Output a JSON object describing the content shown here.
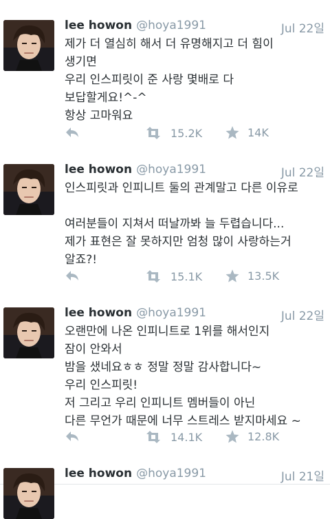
{
  "tweets": [
    {
      "name": "lee howon",
      "handle": "@hoya1991",
      "date": "Jul 22일",
      "lines": [
        "제가 더 열심히 해서 더 유명해지고 더 힘이",
        "생기면",
        "우리 인스피릿이 준 사랑 몇배로 다",
        "보답할게요!^-^",
        "항상 고마워요"
      ],
      "retweets": "15.2K",
      "favorites": "14K"
    },
    {
      "name": "lee howon",
      "handle": "@hoya1991",
      "date": "Jul 22일",
      "lines": [
        "인스피릿과 인피니트 둘의 관계말고 다른 이유로",
        "",
        "여러분들이 지쳐서 떠날까봐 늘 두렵습니다...",
        "제가 표현은 잘 못하지만 엄청 많이 사랑하는거",
        "알죠?!"
      ],
      "retweets": "15.1K",
      "favorites": "13.5K"
    },
    {
      "name": "lee howon",
      "handle": "@hoya1991",
      "date": "Jul 22일",
      "lines": [
        "오랜만에 나온 인피니트로 1위를 해서인지",
        "잠이 안와서",
        "밤을 샜네요ㅎㅎ 정말 정말 감사합니다~",
        "우리 인스피릿!",
        "저 그리고 우리 인피니트 멤버들이 아닌",
        "다른 무언가 때문에 너무 스트레스 받지마세요 ~"
      ],
      "retweets": "14.1K",
      "favorites": "12.8K"
    },
    {
      "name": "lee howon",
      "handle": "@hoya1991",
      "date": "Jul 21일",
      "lines": []
    }
  ],
  "icons": {
    "reply": "reply-icon",
    "retweet": "retweet-icon",
    "favorite": "star-icon"
  },
  "colors": {
    "muted": "#8899a6",
    "text": "#292f33",
    "divider": "#e3e6e8"
  }
}
